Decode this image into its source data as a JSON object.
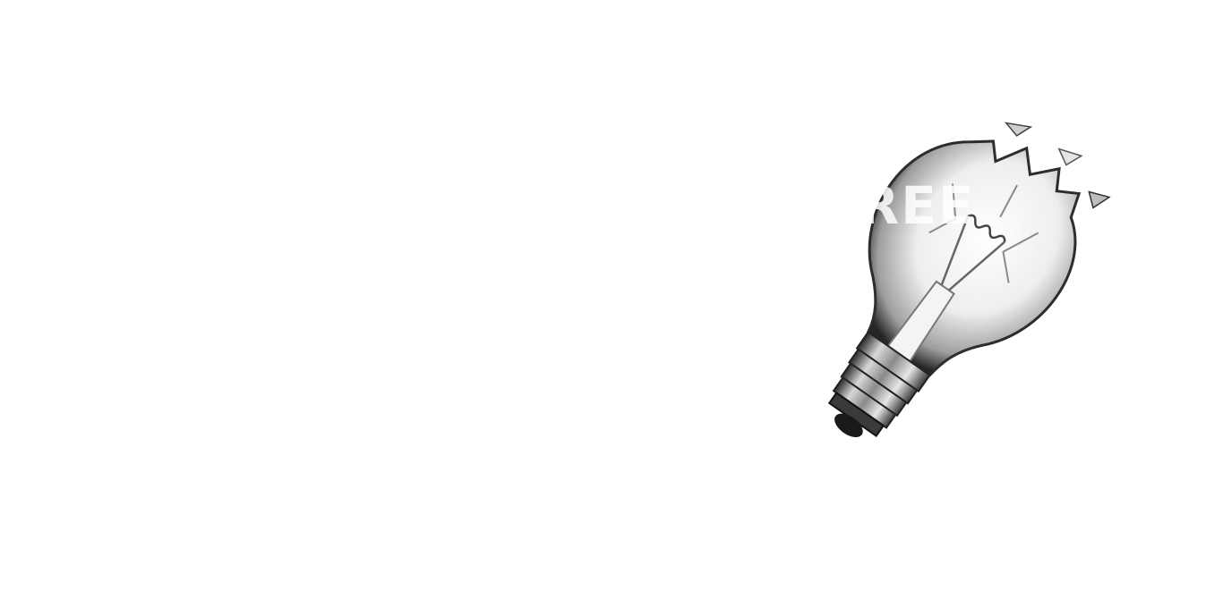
{
  "image": {
    "subject": "broken-light-bulb-icon",
    "background_color": "#ffffff",
    "overlay_text": "TREE"
  }
}
